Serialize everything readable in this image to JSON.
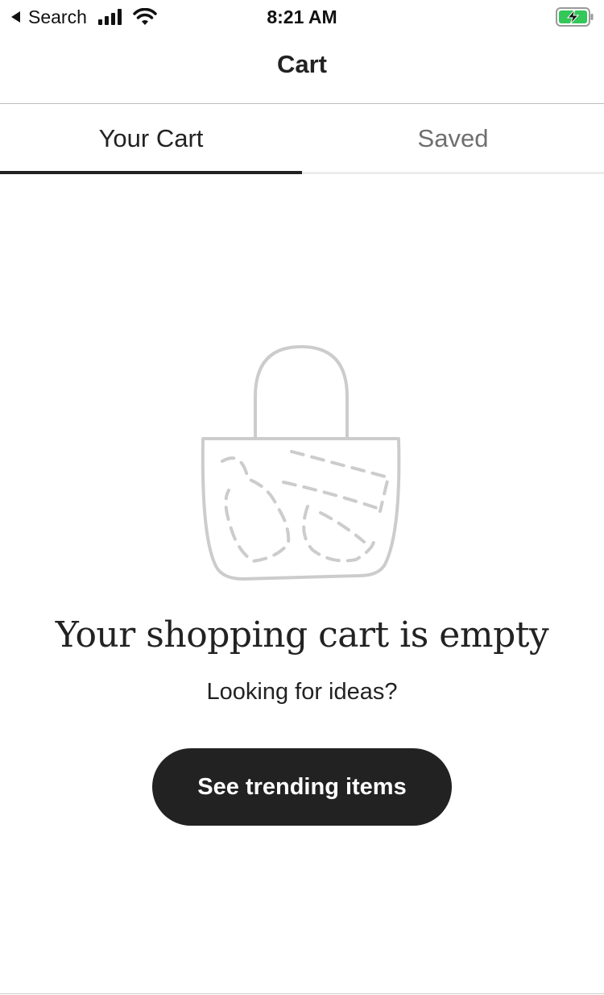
{
  "status_bar": {
    "back_label": "Search",
    "time": "8:21 AM",
    "icons": [
      "back-triangle-icon",
      "cellular-signal-icon",
      "wifi-icon",
      "battery-charging-icon"
    ],
    "battery_color": "#34c759"
  },
  "header": {
    "title": "Cart"
  },
  "tabs": [
    {
      "label": "Your Cart",
      "active": true
    },
    {
      "label": "Saved",
      "active": false
    }
  ],
  "empty_state": {
    "icon": "shopping-bag-icon",
    "title": "Your shopping cart is empty",
    "subtitle": "Looking for ideas?",
    "button_label": "See trending items"
  },
  "colors": {
    "text": "#222222",
    "button_bg": "#222222",
    "button_text": "#ffffff",
    "inactive_tab": "#6f6f6f",
    "illustration": "#cccccc"
  }
}
